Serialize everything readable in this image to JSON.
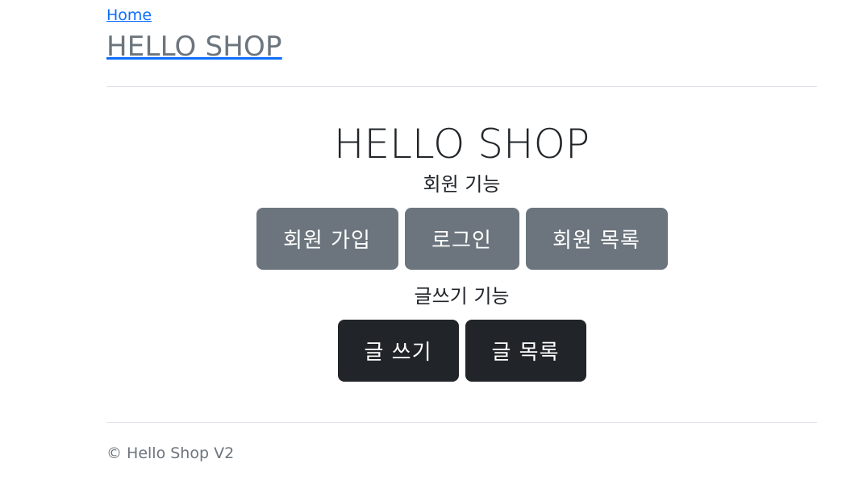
{
  "header": {
    "home_link": "Home",
    "brand": "HELLO SHOP"
  },
  "main": {
    "title": "HELLO SHOP",
    "member_section": {
      "label": "회원 기능",
      "buttons": [
        "회원 가입",
        "로그인",
        "회원 목록"
      ]
    },
    "post_section": {
      "label": "글쓰기 기능",
      "buttons": [
        "글 쓰기",
        "글 목록"
      ]
    }
  },
  "footer": {
    "text": "© Hello Shop V2"
  },
  "colors": {
    "link": "#0d6efd",
    "secondary_button": "#6c757d",
    "dark_button": "#212529",
    "divider": "#dee2e6"
  }
}
